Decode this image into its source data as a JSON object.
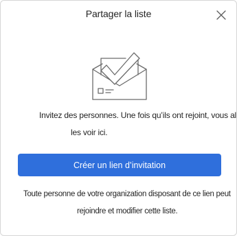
{
  "dialog": {
    "title": "Partager la liste",
    "close_icon": "close-icon",
    "illustration_icon": "envelope-checkmark-icon",
    "description_line1": "Invitez des personnes. Une fois qu’ils ont rejoint, vous allez",
    "description_line2": "les voir ici.",
    "create_link_label": "Créer un lien d’invitation",
    "note_line1": "Toute personne de votre organization disposant de ce lien peut",
    "note_line2": "rejoindre et modifier cette liste.",
    "accent_color": "#2f6fdc"
  }
}
